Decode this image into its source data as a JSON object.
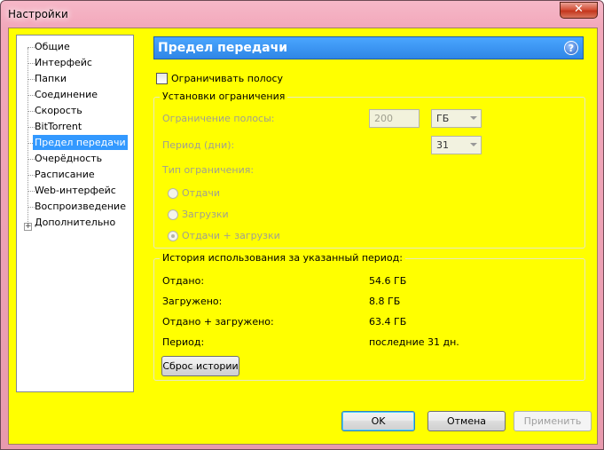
{
  "window": {
    "title": "Настройки",
    "close_glyph": "✕"
  },
  "tree": {
    "items": [
      {
        "label": "Общие"
      },
      {
        "label": "Интерфейс"
      },
      {
        "label": "Папки"
      },
      {
        "label": "Соединение"
      },
      {
        "label": "Скорость"
      },
      {
        "label": "BitTorrent"
      },
      {
        "label": "Предел передачи",
        "selected": true
      },
      {
        "label": "Очерёдность"
      },
      {
        "label": "Расписание"
      },
      {
        "label": "Web-интерфейс"
      },
      {
        "label": "Воспроизведение"
      },
      {
        "label": "Дополнительно",
        "expandable": true
      }
    ],
    "expander_glyph": "+"
  },
  "header": {
    "title": "Предел передачи",
    "help_glyph": "?"
  },
  "limit_checkbox": {
    "label": "Ограничивать полосу",
    "checked": false
  },
  "limit_settings": {
    "title": "Установки ограничения",
    "bandwidth_label": "Ограничение полосы:",
    "bandwidth_value": "200",
    "bandwidth_unit": "ГБ",
    "period_label": "Период (дни):",
    "period_value": "31",
    "type_label": "Тип ограничения:",
    "radio_upload": "Отдачи",
    "radio_download": "Загрузки",
    "radio_both": "Отдачи + загрузки",
    "selected_type": "both"
  },
  "history": {
    "title": "История использования за указанный период:",
    "rows": [
      {
        "label": "Отдано:",
        "value": "54.6 ГБ"
      },
      {
        "label": "Загружено:",
        "value": "8.8 ГБ"
      },
      {
        "label": "Отдано + загружено:",
        "value": "63.4 ГБ"
      },
      {
        "label": "Период:",
        "value": "последние 31 дн."
      }
    ],
    "reset_button": "Сброс истории"
  },
  "buttons": {
    "ok": "OK",
    "cancel": "Отмена",
    "apply": "Применить"
  },
  "colors": {
    "background": "#ffff00",
    "header": "#3399ff",
    "title_bar": "#f2a8bb"
  }
}
